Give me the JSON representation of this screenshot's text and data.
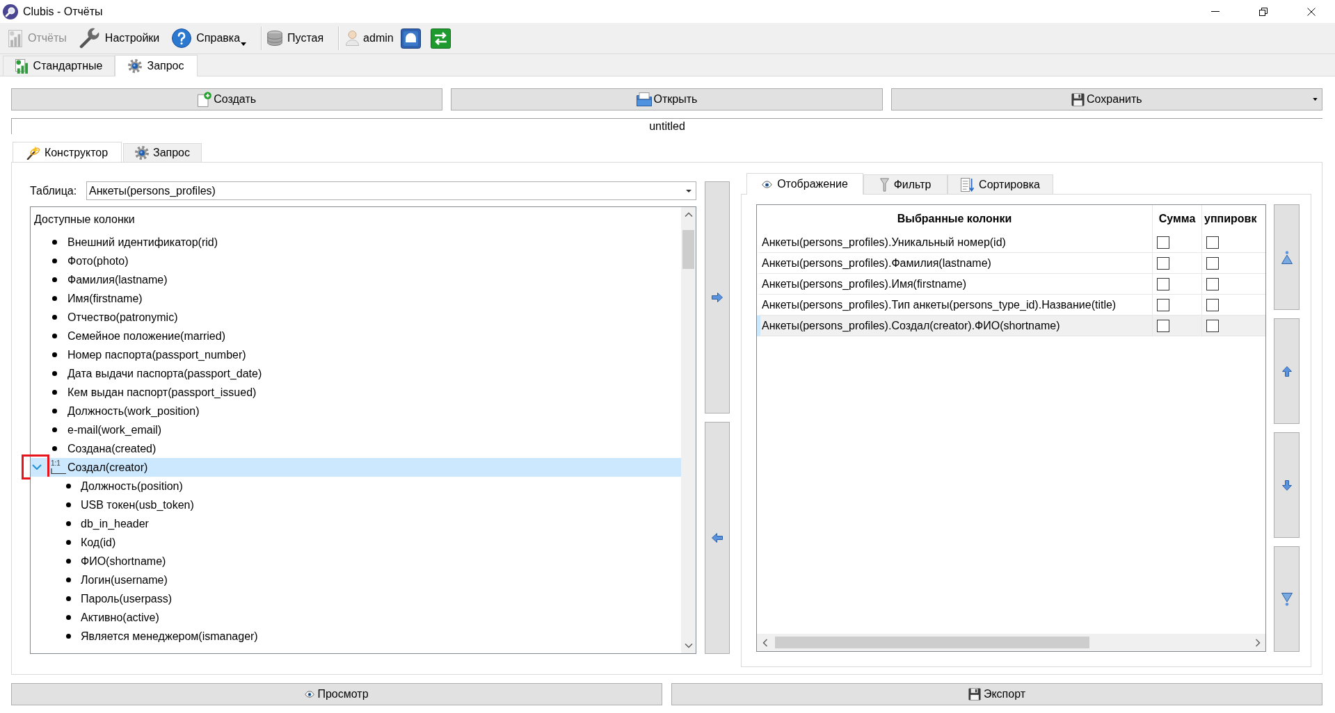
{
  "window": {
    "title": "Clubis - Отчёты"
  },
  "toolbar": {
    "groups": [
      {
        "items": [
          {
            "kind": "action",
            "label": "Отчёты",
            "disabled": true
          },
          {
            "kind": "action",
            "label": "Настройки",
            "disabled": false
          },
          {
            "kind": "menu",
            "label": "Справка",
            "disabled": false
          }
        ]
      },
      {
        "items": [
          {
            "kind": "action",
            "label": "Пустая",
            "disabled": false
          }
        ]
      },
      {
        "items": [
          {
            "kind": "user",
            "label": "admin"
          },
          {
            "kind": "icon"
          },
          {
            "kind": "icon"
          }
        ]
      }
    ]
  },
  "main_tabs": [
    {
      "label": "Стандартные",
      "selected": false
    },
    {
      "label": "Запрос",
      "selected": true
    }
  ],
  "actions": [
    {
      "label": "Создать",
      "has_menu": false
    },
    {
      "label": "Открыть",
      "has_menu": false
    },
    {
      "label": "Сохранить",
      "has_menu": true
    }
  ],
  "document": {
    "title_value": "untitled"
  },
  "editor_tabs": [
    {
      "label": "Конструктор",
      "selected": true
    },
    {
      "label": "Запрос",
      "selected": false
    }
  ],
  "constructor": {
    "table_label": "Таблица:",
    "table_select": {
      "value": "Анкеты(persons_profiles)"
    },
    "available_columns": {
      "title": "Доступные колонки",
      "items": [
        {
          "kind": "field",
          "label": "Внешний идентификатор(rid)",
          "selected": false
        },
        {
          "kind": "field",
          "label": "Фото(photo)",
          "selected": false
        },
        {
          "kind": "field",
          "label": "Фамилия(lastname)",
          "selected": false
        },
        {
          "kind": "field",
          "label": "Имя(firstname)",
          "selected": false
        },
        {
          "kind": "field",
          "label": "Отчество(patronymic)",
          "selected": false
        },
        {
          "kind": "field",
          "label": "Семейное положение(married)",
          "selected": false
        },
        {
          "kind": "field",
          "label": "Номер паспорта(passport_number)",
          "selected": false
        },
        {
          "kind": "field",
          "label": "Дата выдачи паспорта(passport_date)",
          "selected": false
        },
        {
          "kind": "field",
          "label": "Кем выдан паспорт(passport_issued)",
          "selected": false
        },
        {
          "kind": "field",
          "label": "Должность(work_position)",
          "selected": false
        },
        {
          "kind": "field",
          "label": "e-mail(work_email)",
          "selected": false
        },
        {
          "kind": "field",
          "label": "Создана(created)",
          "selected": false
        },
        {
          "kind": "relation",
          "label": "Создал(creator)",
          "relation": "1:1",
          "selected": true,
          "expanded": true,
          "highlighted": true,
          "children": [
            {
              "kind": "field",
              "label": "Должность(position)",
              "selected": false
            },
            {
              "kind": "field",
              "label": "USB токен(usb_token)",
              "selected": false
            },
            {
              "kind": "field",
              "label": "db_in_header",
              "selected": false
            },
            {
              "kind": "field",
              "label": "Код(id)",
              "selected": false
            },
            {
              "kind": "field",
              "label": "ФИО(shortname)",
              "selected": false
            },
            {
              "kind": "field",
              "label": "Логин(username)",
              "selected": false
            },
            {
              "kind": "field",
              "label": "Пароль(userpass)",
              "selected": false
            },
            {
              "kind": "field",
              "label": "Активно(active)",
              "selected": false
            },
            {
              "kind": "field",
              "label": "Является менеджером(ismanager)",
              "selected": false
            }
          ]
        }
      ]
    },
    "view_tabs": [
      {
        "label": "Отображение",
        "selected": true
      },
      {
        "label": "Фильтр",
        "selected": false
      },
      {
        "label": "Сортировка",
        "selected": false
      }
    ],
    "selected_columns": {
      "columns": [
        "Выбранные колонки",
        "Сумма",
        "уппировк"
      ],
      "rows": [
        {
          "label": "Анкеты(persons_profiles).Уникальный номер(id)",
          "sum": false,
          "group": false,
          "selected": false
        },
        {
          "label": "Анкеты(persons_profiles).Фамилия(lastname)",
          "sum": false,
          "group": false,
          "selected": false
        },
        {
          "label": "Анкеты(persons_profiles).Имя(firstname)",
          "sum": false,
          "group": false,
          "selected": false
        },
        {
          "label": "Анкеты(persons_profiles).Тип анкеты(persons_type_id).Название(title)",
          "sum": false,
          "group": false,
          "selected": false
        },
        {
          "label": "Анкеты(persons_profiles).Создал(creator).ФИО(shortname)",
          "sum": false,
          "group": false,
          "selected": true
        }
      ]
    }
  },
  "footer_buttons": [
    {
      "label": "Просмотр"
    },
    {
      "label": "Экспорт"
    }
  ]
}
